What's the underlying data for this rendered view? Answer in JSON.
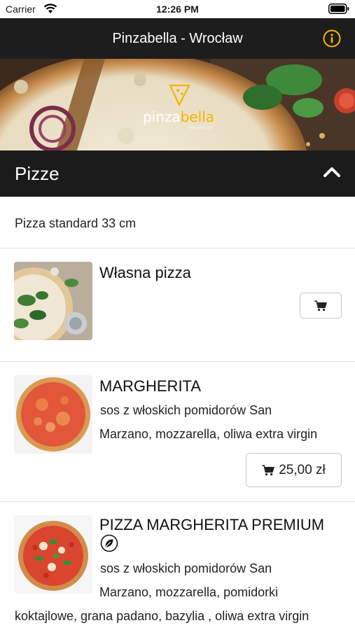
{
  "status_bar": {
    "carrier": "Carrier",
    "time": "12:26 PM"
  },
  "nav": {
    "title": "Pinzabella - Wrocław",
    "info_icon": "info-icon",
    "accent_color": "#f5b400"
  },
  "banner": {
    "brand_text": "pinzabella"
  },
  "section": {
    "title": "Pizze",
    "state_icon": "chevron-up-icon"
  },
  "subcategory": {
    "label": "Pizza standard 33 cm"
  },
  "products": [
    {
      "name": "Własna pizza",
      "description": "",
      "price": "",
      "cart_icon": "cart-icon"
    },
    {
      "name": "MARGHERITA",
      "description_lines": [
        " sos z włoskich pomidorów San",
        "Marzano, mozzarella, oliwa extra virgin"
      ],
      "price": "25,00 zł",
      "cart_icon": "cart-icon"
    },
    {
      "name": "PIZZA MARGHERITA PREMIUM",
      "badge_icon": "leaf-icon",
      "description_lines": [
        " sos z włoskich pomidorów San",
        "Marzano, mozzarella, pomidorki",
        "koktajlowe, grana padano, bazylia , oliwa extra virgin"
      ]
    }
  ]
}
